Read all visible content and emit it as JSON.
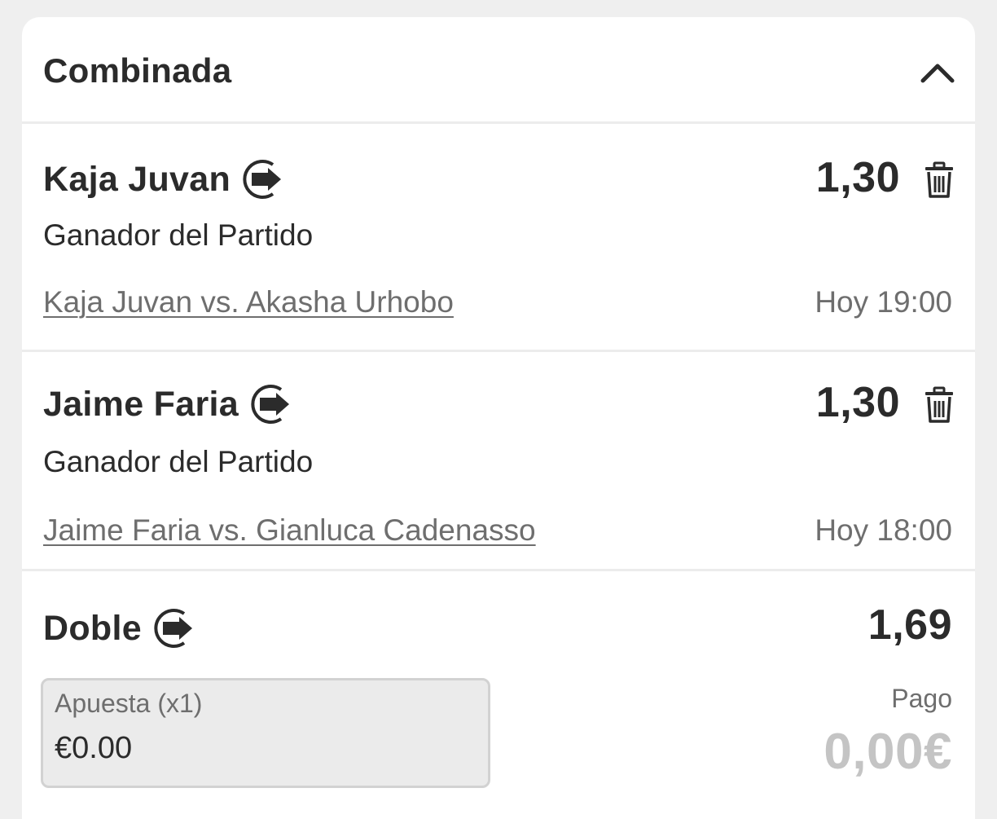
{
  "slip": {
    "title": "Combinada",
    "selections": [
      {
        "name": "Kaja Juvan",
        "odds": "1,30",
        "market": "Ganador del Partido",
        "event": "Kaja Juvan vs. Akasha Urhobo",
        "time": "Hoy 19:00"
      },
      {
        "name": "Jaime Faria",
        "odds": "1,30",
        "market": "Ganador del Partido",
        "event": "Jaime Faria vs. Gianluca Cadenasso",
        "time": "Hoy 18:00"
      }
    ],
    "bet": {
      "type": "Doble",
      "total_odds": "1,69",
      "stake_label": "Apuesta (x1)",
      "stake_value": "€0.00",
      "payout_label": "Pago",
      "payout_value": "0,00€"
    }
  },
  "icons": {
    "collapse": "chevron-up-icon",
    "cashout": "cashout-icon",
    "remove": "trash-icon"
  },
  "colors": {
    "text": "#2b2b2b",
    "muted": "#6e6e6e",
    "payout_disabled": "#c4c4c4",
    "input_bg": "#ebebeb",
    "page_bg": "#efefef"
  }
}
